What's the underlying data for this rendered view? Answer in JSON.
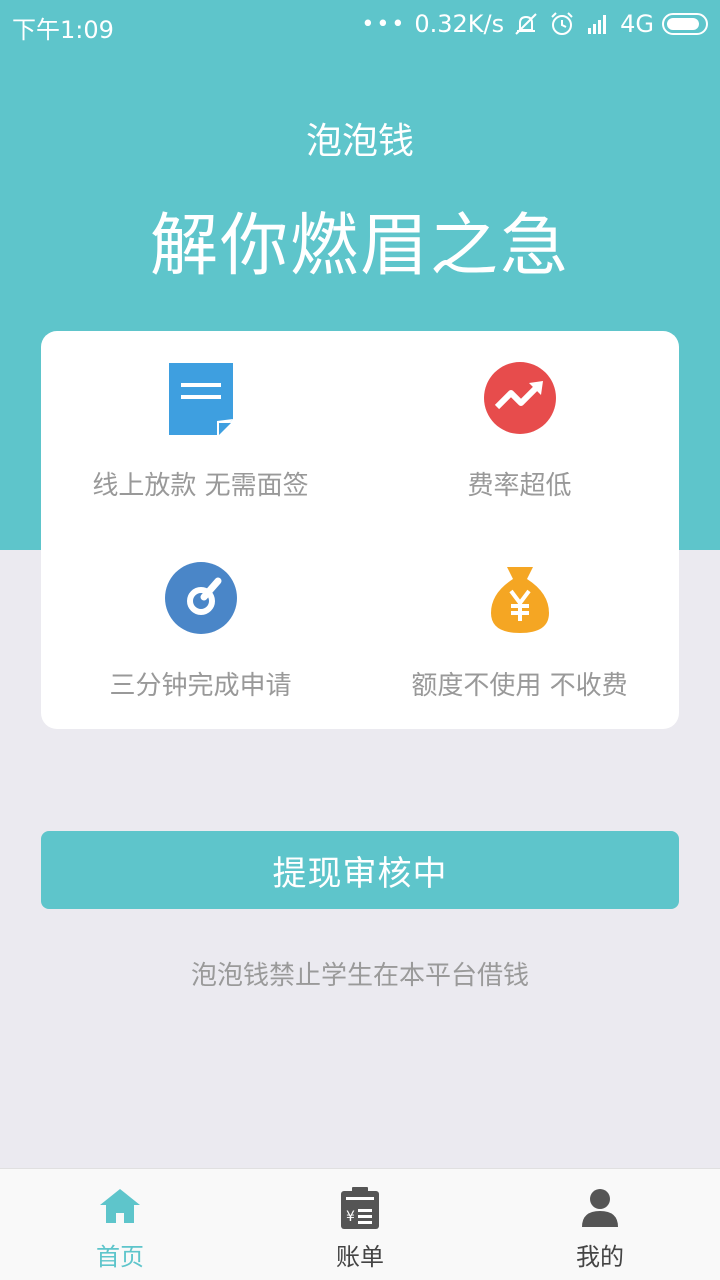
{
  "status_bar": {
    "time": "下午1:09",
    "network_speed": "0.32K/s",
    "network_type": "4G",
    "icons": [
      "dots-icon",
      "mute-icon",
      "alarm-icon",
      "signal-icon",
      "battery-icon"
    ]
  },
  "header": {
    "app_name": "泡泡钱",
    "slogan": "解你燃眉之急"
  },
  "features": [
    {
      "label": "线上放款 无需面签",
      "icon": "document-icon",
      "color": "#3e9fe0"
    },
    {
      "label": "费率超低",
      "icon": "trend-up-icon",
      "color": "#e74c4c"
    },
    {
      "label": "三分钟完成申请",
      "icon": "gauge-icon",
      "color": "#4a86c8"
    },
    {
      "label": "额度不使用 不收费",
      "icon": "money-bag-icon",
      "color": "#f5a623"
    }
  ],
  "main": {
    "button_label": "提现审核中",
    "notice": "泡泡钱禁止学生在本平台借钱"
  },
  "tab_bar": {
    "tabs": [
      {
        "label": "首页",
        "icon": "home-icon",
        "active": true
      },
      {
        "label": "账单",
        "icon": "bill-icon",
        "active": false
      },
      {
        "label": "我的",
        "icon": "user-icon",
        "active": false
      }
    ]
  },
  "colors": {
    "accent": "#5ec5cb",
    "background": "#ebeaf0",
    "inactive_tab": "#444444"
  }
}
